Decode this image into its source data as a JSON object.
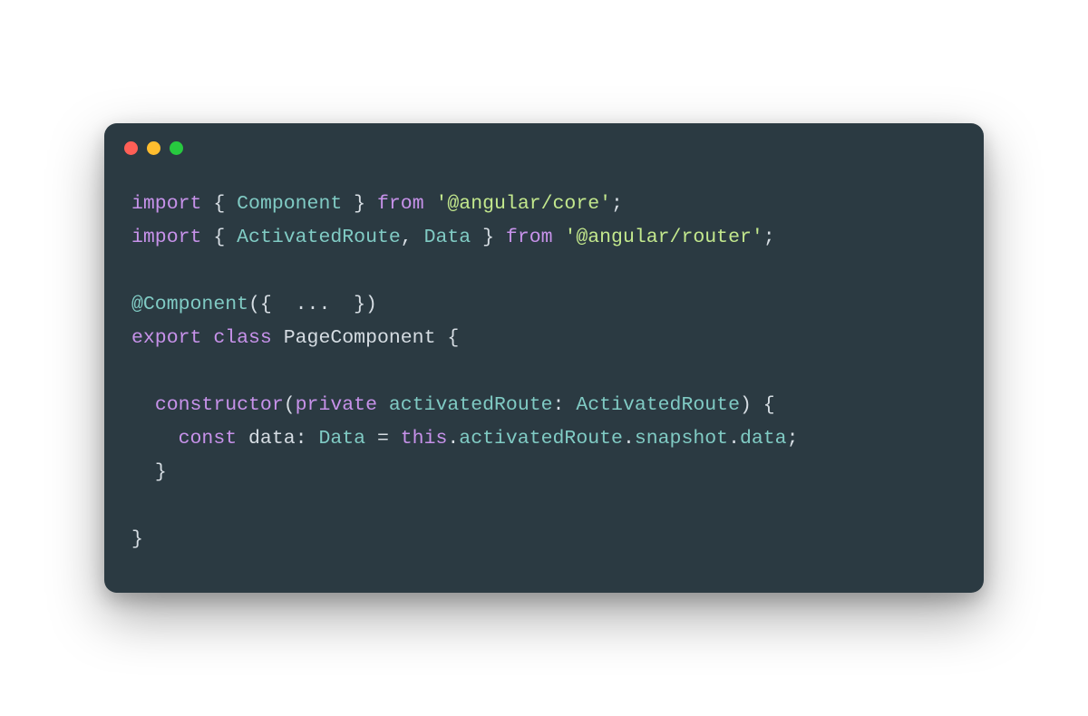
{
  "titlebar": {
    "dots": [
      "red",
      "yellow",
      "green"
    ]
  },
  "code": {
    "line1": {
      "t1": "import",
      "t2": " { ",
      "t3": "Component",
      "t4": " } ",
      "t5": "from",
      "t6": " ",
      "t7": "'@angular/core'",
      "t8": ";"
    },
    "line2": {
      "t1": "import",
      "t2": " { ",
      "t3": "ActivatedRoute",
      "t4": ", ",
      "t5": "Data",
      "t6": " } ",
      "t7": "from",
      "t8": " ",
      "t9": "'@angular/router'",
      "t10": ";"
    },
    "line3": "",
    "line4": {
      "t1": "@Component",
      "t2": "({  ...  })"
    },
    "line5": {
      "t1": "export",
      "t2": " ",
      "t3": "class",
      "t4": " ",
      "t5": "PageComponent",
      "t6": " {"
    },
    "line6": "",
    "line7": {
      "t0": "  ",
      "t1": "constructor",
      "t2": "(",
      "t3": "private",
      "t4": " ",
      "t5": "activatedRoute",
      "t6": ": ",
      "t7": "ActivatedRoute",
      "t8": ") {"
    },
    "line8": {
      "t0": "    ",
      "t1": "const",
      "t2": " ",
      "t3": "data",
      "t4": ": ",
      "t5": "Data",
      "t6": " = ",
      "t7": "this",
      "t8": ".",
      "t9": "activatedRoute",
      "t10": ".",
      "t11": "snapshot",
      "t12": ".",
      "t13": "data",
      "t14": ";"
    },
    "line9": {
      "t0": "  ",
      "t1": "}"
    },
    "line10": "",
    "line11": {
      "t1": "}"
    }
  }
}
